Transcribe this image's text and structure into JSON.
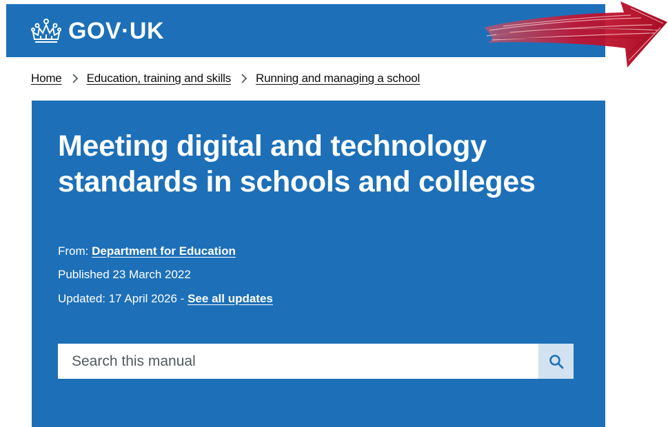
{
  "header": {
    "logo_text": "GOV·UK",
    "logo_icon": "crown-icon",
    "brand_color": "#1d70b8"
  },
  "annotation": {
    "icon": "red-arrow-icon",
    "color": "#c8102e"
  },
  "breadcrumb": {
    "items": [
      {
        "label": "Home"
      },
      {
        "label": "Education, training and skills"
      },
      {
        "label": "Running and managing a school"
      }
    ]
  },
  "hero": {
    "title": "Meeting digital and technology standards in schools and colleges",
    "from_label": "From:",
    "from_link": "Department for Education",
    "published_label": "Published",
    "published_date": "23 March 2022",
    "updated_label": "Updated: 17 April 2026 -",
    "updates_link": "See all updates"
  },
  "search": {
    "placeholder": "Search this manual",
    "value": "",
    "button_icon": "search-icon",
    "button_color": "#d2e2f1"
  }
}
